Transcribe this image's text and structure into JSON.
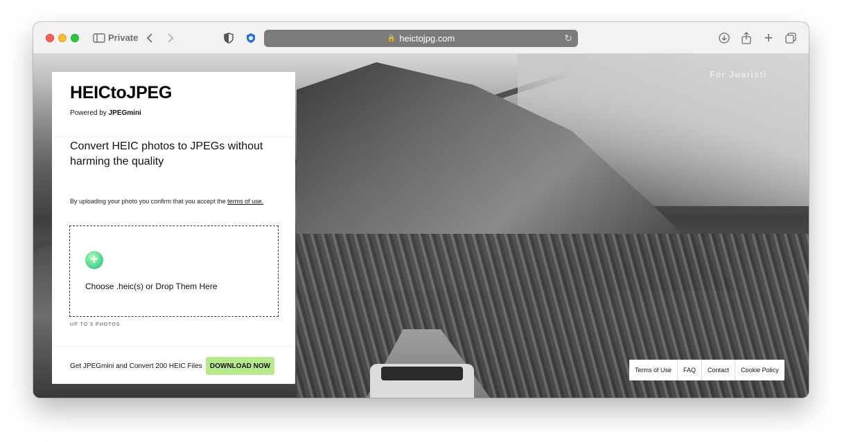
{
  "browser": {
    "mode_label": "Private",
    "url": "heictojpg.com"
  },
  "page": {
    "photo_credit": "Fer Juaristi",
    "brand": {
      "title": "HEICtoJPEG",
      "powered_prefix": "Powered by",
      "powered_name": "JPEGmini"
    },
    "headline": "Convert HEIC photos to JPEGs without harming the quality",
    "terms": {
      "text": "By uploading your photo you confirm that you accept the",
      "link": "terms of use."
    },
    "dropzone": {
      "icon": "plus-icon",
      "label": "Choose .heic(s) or Drop Them Here"
    },
    "limit_note": "UP TO 5 PHOTOS",
    "promo": {
      "text": "Get JPEGmini and Convert 200 HEIC Files",
      "button": "DOWNLOAD NOW",
      "button_color": "#b6ea8a"
    },
    "footer_links": [
      "Terms of Use",
      "FAQ",
      "Contact",
      "Cookie Policy"
    ]
  }
}
